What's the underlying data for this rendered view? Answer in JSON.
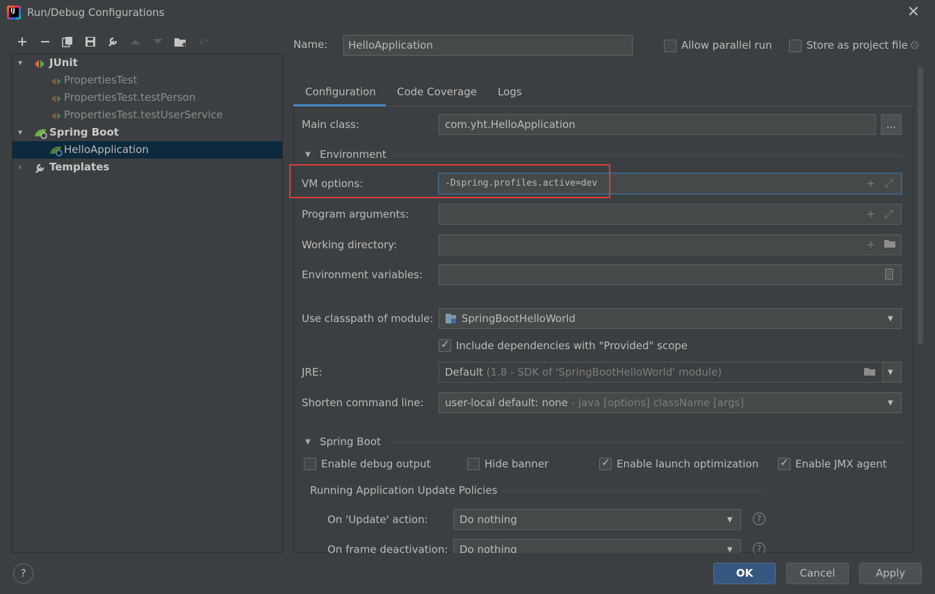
{
  "window": {
    "title": "Run/Debug Configurations"
  },
  "toolbar": {
    "icons": [
      "add-icon",
      "remove-icon",
      "copy-icon",
      "save-icon",
      "wrench-icon",
      "move-up-icon",
      "move-down-icon",
      "new-folder-icon",
      "sort-icon"
    ]
  },
  "tree": {
    "items": [
      {
        "label": "JUnit",
        "level": 0,
        "expanded": true,
        "icon": "junit-icon"
      },
      {
        "label": "PropertiesTest",
        "level": 1,
        "icon": "test-icon"
      },
      {
        "label": "PropertiesTest.testPerson",
        "level": 1,
        "icon": "test-icon"
      },
      {
        "label": "PropertiesTest.testUserService",
        "level": 1,
        "icon": "test-icon"
      },
      {
        "label": "Spring Boot",
        "level": 0,
        "expanded": true,
        "icon": "spring-boot-icon"
      },
      {
        "label": "HelloApplication",
        "level": 1,
        "selected": true,
        "icon": "spring-boot-app-icon"
      },
      {
        "label": "Templates",
        "level": 0,
        "expanded": false,
        "icon": "wrench-icon"
      }
    ]
  },
  "header": {
    "name_label": "Name:",
    "name_value": "HelloApplication",
    "allow_parallel_label": "Allow parallel run",
    "allow_parallel_checked": false,
    "store_project_label": "Store as project file",
    "store_project_checked": false
  },
  "tabs": [
    {
      "label": "Configuration",
      "active": true
    },
    {
      "label": "Code Coverage",
      "active": false
    },
    {
      "label": "Logs",
      "active": false
    }
  ],
  "form": {
    "main_class_label": "Main class:",
    "main_class_value": "com.yht.HelloApplication",
    "browse_label": "...",
    "environment_section": "Environment",
    "vm_options_label": "VM options:",
    "vm_options_value": "-Dspring.profiles.active=dev",
    "program_args_label": "Program arguments:",
    "working_dir_label": "Working directory:",
    "env_vars_label": "Environment variables:",
    "classpath_label": "Use classpath of module:",
    "classpath_value": "SpringBootHelloWorld",
    "include_deps_label": "Include dependencies with \"Provided\" scope",
    "include_deps_checked": true,
    "jre_label": "JRE:",
    "jre_value": "Default",
    "jre_detail": "(1.8 - SDK of 'SpringBootHelloWorld' module)",
    "shorten_label": "Shorten command line:",
    "shorten_value": "user-local default: none",
    "shorten_detail": "- java [options] className [args]",
    "spring_boot_section": "Spring Boot",
    "enable_debug_label": "Enable debug output",
    "enable_debug_checked": false,
    "hide_banner_label": "Hide banner",
    "hide_banner_checked": false,
    "launch_opt_label": "Enable launch optimization",
    "launch_opt_checked": true,
    "jmx_label": "Enable JMX agent",
    "jmx_checked": true,
    "update_policies_section": "Running Application Update Policies",
    "on_update_label": "On 'Update' action:",
    "on_update_value": "Do nothing",
    "on_frame_label": "On frame deactivation:",
    "on_frame_value": "Do nothing"
  },
  "footer": {
    "help_label": "?",
    "ok_label": "OK",
    "cancel_label": "Cancel",
    "apply_label": "Apply"
  },
  "colors": {
    "background": "#3c3f41",
    "selection": "#0d293e",
    "accent": "#4a88c7",
    "ok_button": "#365880",
    "highlight_box": "#e03c3c"
  }
}
